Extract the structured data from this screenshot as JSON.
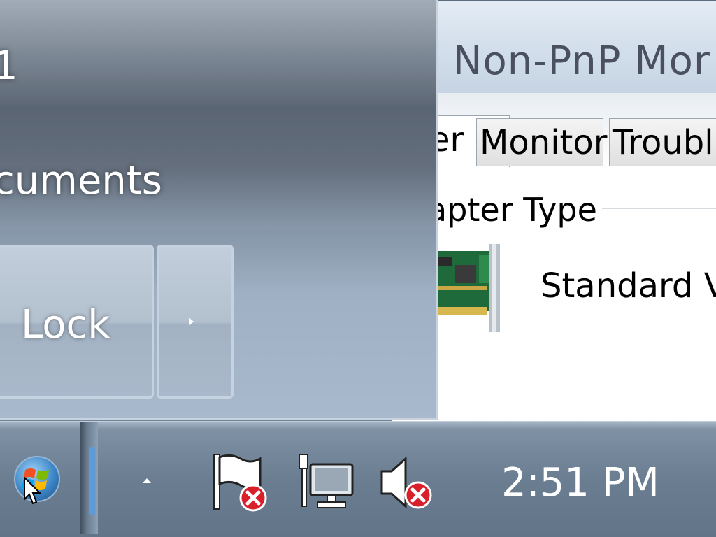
{
  "properties_window": {
    "title": "c Non-PnP Mor",
    "tabs": [
      {
        "label": "er"
      },
      {
        "label": "Monitor"
      },
      {
        "label": "Troubl"
      }
    ],
    "group_label": "apter Type",
    "adapter_name": "Standard V",
    "adapter_icon": "video-card-icon"
  },
  "start_menu": {
    "item_partial_1": "1",
    "item_documents": "cuments",
    "lock_label": "Lock",
    "lock_arrow_icon": "chevron-right-icon"
  },
  "taskbar": {
    "start_icon": "windows-orb-icon",
    "tray_expand_icon": "chevron-up-icon",
    "tray_icons": [
      "action-center-flag-error-icon",
      "network-error-icon",
      "volume-muted-error-icon"
    ],
    "clock": "2:51 PM"
  },
  "colors": {
    "error_red": "#d9202a",
    "taskbar": "#6a7d91",
    "start_menu_dark": "#475362"
  }
}
